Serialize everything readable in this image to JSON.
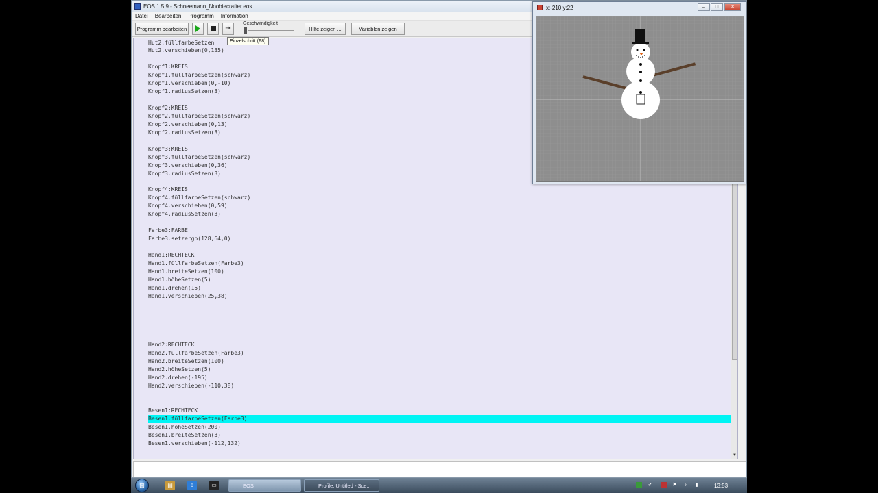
{
  "window": {
    "title": "EOS 1.5.9 - Schneemann_Noobiecrafter.eos"
  },
  "menu": [
    "Datei",
    "Bearbeiten",
    "Programm",
    "Information"
  ],
  "toolbar": {
    "edit_label": "Programm bearbeiten",
    "speed_label": "Geschwindigkeit",
    "help_label": "Hilfe zeigen ...",
    "vars_label": "Variablen zeigen",
    "tooltip": "Einzelschritt (F8)"
  },
  "code_lines": [
    "Hut2.füllfarbeSetzen",
    "Hut2.verschieben(0,135)",
    "",
    "Knopf1:KREIS",
    "Knopf1.füllfarbeSetzen(schwarz)",
    "Knopf1.verschieben(0,-10)",
    "Knopf1.radiusSetzen(3)",
    "",
    "Knopf2:KREIS",
    "Knopf2.füllfarbeSetzen(schwarz)",
    "Knopf2.verschieben(0,13)",
    "Knopf2.radiusSetzen(3)",
    "",
    "Knopf3:KREIS",
    "Knopf3.füllfarbeSetzen(schwarz)",
    "Knopf3.verschieben(0,36)",
    "Knopf3.radiusSetzen(3)",
    "",
    "Knopf4:KREIS",
    "Knopf4.füllfarbeSetzen(schwarz)",
    "Knopf4.verschieben(0,59)",
    "Knopf4.radiusSetzen(3)",
    "",
    "Farbe3:FARBE",
    "Farbe3.setzergb(128,64,0)",
    "",
    "Hand1:RECHTECK",
    "Hand1.füllfarbeSetzen(Farbe3)",
    "Hand1.breiteSetzen(100)",
    "Hand1.höheSetzen(5)",
    "Hand1.drehen(15)",
    "Hand1.verschieben(25,38)",
    "",
    "",
    "",
    "",
    "",
    "Hand2:RECHTECK",
    "Hand2.füllfarbeSetzen(Farbe3)",
    "Hand2.breiteSetzen(100)",
    "Hand2.höheSetzen(5)",
    "Hand2.drehen(-195)",
    "Hand2.verschieben(-110,38)",
    "",
    "",
    "Besen1:RECHTECK",
    "Besen1.füllfarbeSetzen(Farbe3)",
    "Besen1.höheSetzen(200)",
    "Besen1.breiteSetzen(3)",
    "Besen1.verschieben(-112,132)"
  ],
  "highlighted_line": 46,
  "canvas_window": {
    "title": "x:-210 y:22"
  },
  "taskbar": {
    "tasks": [
      "EOS",
      "Profile: Untitled - Sce..."
    ],
    "clock": "13:53"
  },
  "colors": {
    "editor_bg": "#e8e6f6",
    "highlight": "#00f4f4",
    "arm": "#80400 0"
  }
}
